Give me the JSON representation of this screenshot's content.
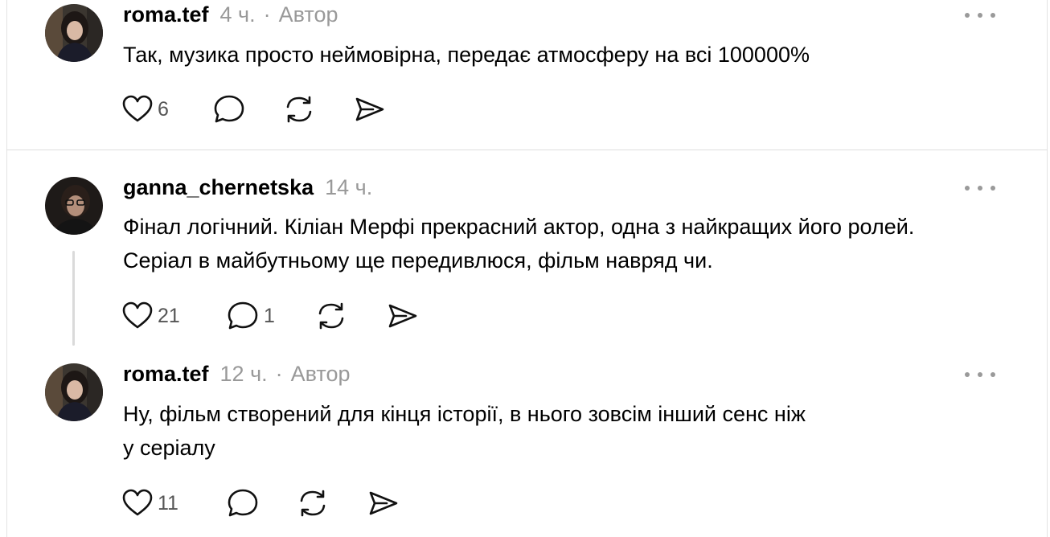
{
  "comments": [
    {
      "username": "roma.tef",
      "time": "4 ч.",
      "separator": "·",
      "author_label": "Автор",
      "text": "Так, музика просто неймовірна, передає атмосферу на всі 100000%",
      "likes": "6",
      "replies": "",
      "avatar_icon": "avatar-woman-dark-hair"
    },
    {
      "username": "ganna_chernetska",
      "time": "14 ч.",
      "text": "Фінал логічний. Кіліан Мерфі прекрасний актор, одна з найкращих його ролей. Серіал в майбутньому ще передивлюся, фільм навряд чи.",
      "likes": "21",
      "replies": "1",
      "avatar_icon": "avatar-woman-glasses"
    },
    {
      "username": "roma.tef",
      "time": "12 ч.",
      "separator": "·",
      "author_label": "Автор",
      "text_line1": "Ну, фільм створений для кінця історії, в нього зовсім інший сенс ніж",
      "text_line2": "у серіалу",
      "likes": "11",
      "replies": "",
      "avatar_icon": "avatar-woman-dark-hair"
    }
  ],
  "icons": {
    "like": "heart-icon",
    "reply": "speech-bubble-icon",
    "repost": "repost-icon",
    "share": "paper-plane-icon",
    "more": "more-dots-icon"
  },
  "colors": {
    "text": "#000000",
    "muted": "#999999",
    "icon": "#111111",
    "divider": "#dedede"
  }
}
